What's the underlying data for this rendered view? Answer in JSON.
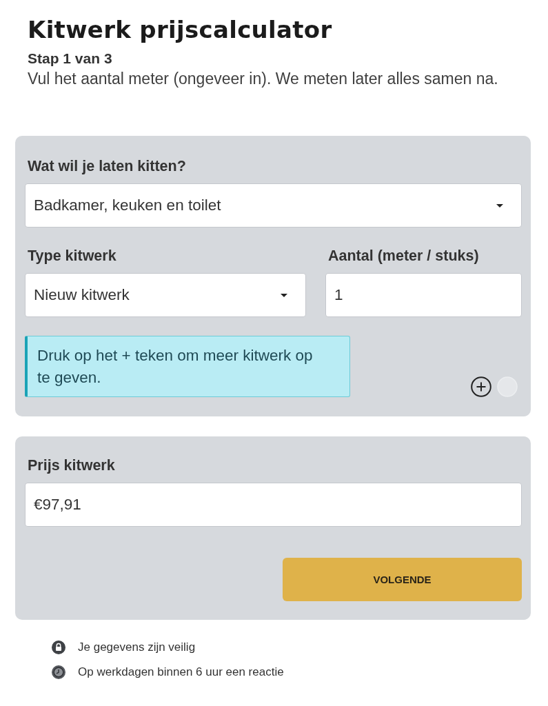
{
  "header": {
    "title": "Kitwerk prijscalculator",
    "step": "Stap 1 van 3",
    "intro": "Vul het aantal meter (ongeveer in). We meten later alles samen na."
  },
  "selection_card": {
    "job_field": {
      "kind": "select",
      "label": "Wat wil je laten kitten?",
      "value": "Badkamer, keuken en toilet"
    },
    "item_fields": [
      {
        "kind": "select",
        "label": "Type kitwerk",
        "value": "Nieuw kitwerk"
      },
      {
        "kind": "input",
        "label": "Aantal (meter / stuks)",
        "value": "1"
      }
    ],
    "hint": "Druk op het + teken om meer kitwerk op te geven.",
    "row_actions": [
      {
        "kind": "add",
        "disabled": false
      },
      {
        "kind": "remove",
        "disabled": true
      }
    ]
  },
  "price_card": {
    "price_field": {
      "kind": "input",
      "label": "Prijs kitwerk",
      "value": "€97,91"
    },
    "next_button": "VOLGENDE"
  },
  "assurances": [
    {
      "kind": "lock",
      "text": "Je gegevens zijn veilig"
    },
    {
      "kind": "clock",
      "text": "Op werkdagen binnen 6 uur een reactie"
    }
  ]
}
